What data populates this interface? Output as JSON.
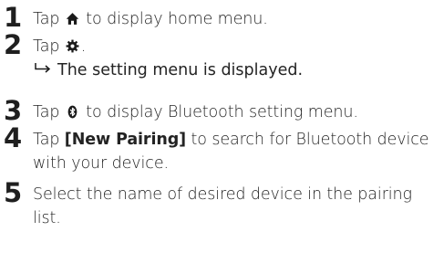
{
  "steps": [
    {
      "number": "1",
      "before": "Tap ",
      "icon": "home-icon",
      "after": " to display home menu."
    },
    {
      "number": "2",
      "before": "Tap ",
      "icon": "gear-icon",
      "after": ".",
      "result": "The setting menu is displayed."
    },
    {
      "number": "3",
      "before": "Tap ",
      "icon": "bluetooth-icon",
      "after": " to display Bluetooth setting menu."
    },
    {
      "number": "4",
      "before": "Tap ",
      "bold": "[New Pairing]",
      "after": " to search for Bluetooth device with your device."
    },
    {
      "number": "5",
      "text": "Select the name of desired device in the pairing list."
    }
  ]
}
